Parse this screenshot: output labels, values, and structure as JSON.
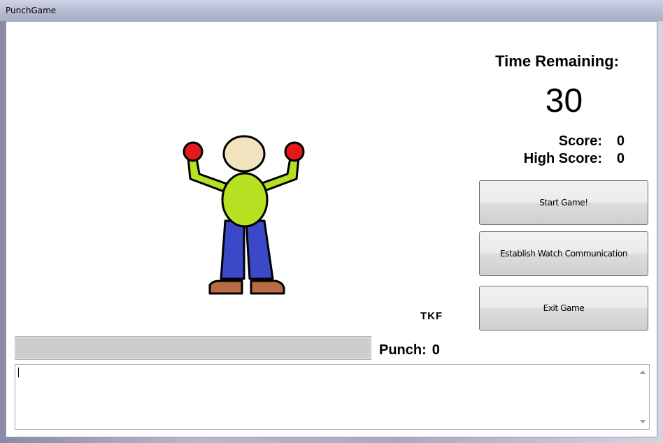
{
  "window": {
    "title": "PunchGame"
  },
  "game": {
    "time_label": "Time Remaining:",
    "time_value": "30",
    "score_label": "Score:",
    "score_value": "0",
    "high_score_label": "High Score:",
    "high_score_value": "0",
    "tkf_label": "TKF",
    "punch_label": "Punch:",
    "punch_value": "0",
    "progress_fraction": 1.0
  },
  "buttons": {
    "start": "Start Game!",
    "watch": "Establish Watch Communication",
    "exit": "Exit Game"
  },
  "log": {
    "text": ""
  },
  "colors": {
    "glove": "#e31a1a",
    "head": "#f1e3bd",
    "shirt": "#b6e022",
    "pants": "#3b49c9",
    "shoes": "#b86b45"
  }
}
